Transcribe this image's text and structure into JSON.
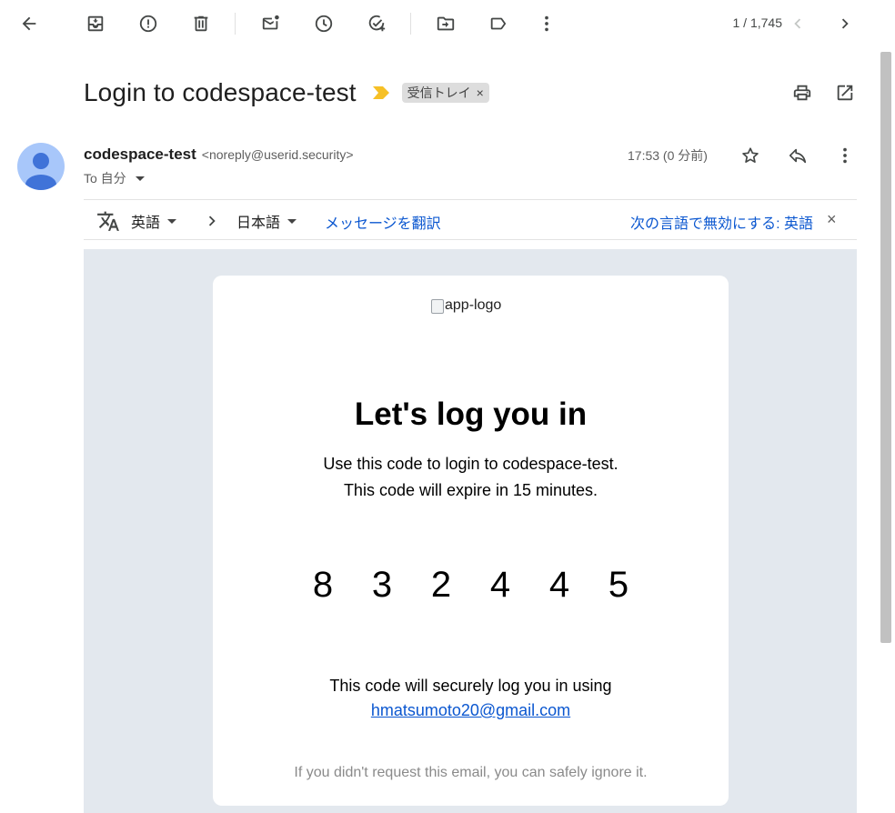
{
  "toolbar": {
    "back_icon": "arrow-left-icon",
    "archive_icon": "archive-icon",
    "report_icon": "report-spam-icon",
    "delete_icon": "trash-icon",
    "mark_unread_icon": "mark-unread-icon",
    "snooze_icon": "snooze-clock-icon",
    "add_task_icon": "add-task-icon",
    "move_icon": "move-to-icon",
    "label_icon": "label-icon",
    "more_icon": "more-vert-icon",
    "pager": "1 / 1,745"
  },
  "email": {
    "subject": "Login to codespace-test",
    "label_chip": "受信トレイ",
    "label_chip_close": "×",
    "sender_name": "codespace-test",
    "sender_email": "<noreply@userid.security>",
    "to_text": "To 自分",
    "time": "17:53 (0 分前)"
  },
  "translate": {
    "source_lang": "英語",
    "target_lang": "日本語",
    "translate_link": "メッセージを翻訳",
    "disable_link": "次の言語で無効にする: 英語",
    "close": "×"
  },
  "body": {
    "logo_alt": "app-logo",
    "headline": "Let's log you in",
    "line1": "Use this code to login to codespace-test.",
    "line2": "This code will expire in 15 minutes.",
    "code_digits": [
      "8",
      "3",
      "2",
      "4",
      "4",
      "5"
    ],
    "secure_text": "This code will securely log you in using",
    "secure_email": "hmatsumoto20@gmail.com",
    "ignore_text": "If you didn't request this email, you can safely ignore it."
  },
  "colors": {
    "link": "#0b57d0",
    "body_bg": "#e3e8ee",
    "avatar_bg": "#a8c7fa",
    "importance": "#f6c026",
    "chip_bg": "#dddddd"
  }
}
